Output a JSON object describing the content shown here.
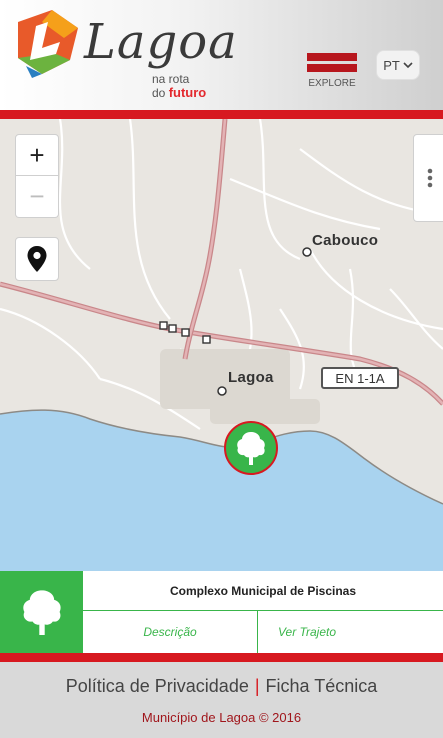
{
  "header": {
    "logo_title": "Lagoa",
    "logo_tagline_1": "na rota",
    "logo_tagline_2_prefix": "do",
    "logo_tagline_2_accent": "futuro",
    "explore_label": "EXPLORE",
    "language": "PT",
    "brand_red": "#d71920"
  },
  "map": {
    "zoom_in_label": "+",
    "zoom_out_label": "−",
    "places": {
      "cabouco": "Cabouco",
      "lagoa": "Lagoa"
    },
    "road_label": "EN 1-1A",
    "marker_icon": "tree-icon",
    "sea_color": "#a9d3ef",
    "land_color": "#e9e6e1"
  },
  "info": {
    "title": "Complexo Municipal de Piscinas",
    "description_link": "Descrição",
    "route_link": "Ver Trajeto",
    "accent_color": "#39b54a"
  },
  "footer": {
    "privacy": "Política de Privacidade",
    "separator": "|",
    "credits": "Ficha Técnica",
    "copyright": "Município de Lagoa © 2016"
  }
}
